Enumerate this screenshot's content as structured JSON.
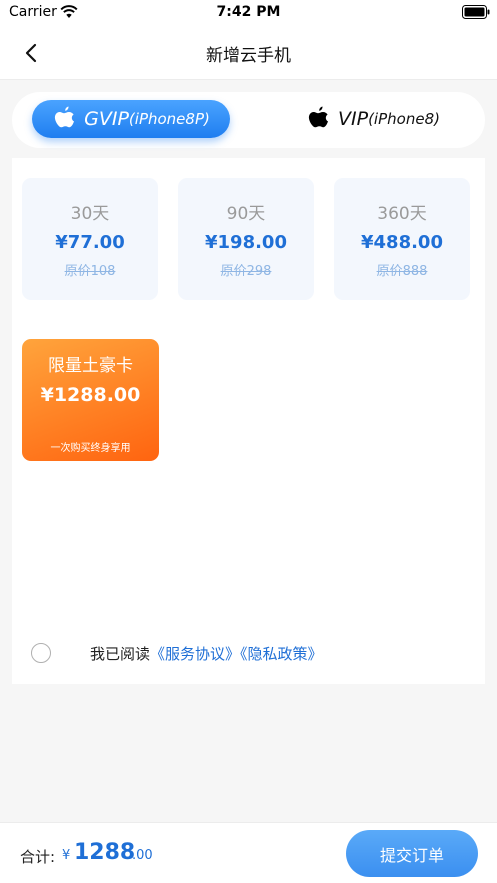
{
  "status_bar": {
    "carrier": "Carrier",
    "time": "7:42 PM"
  },
  "nav": {
    "title": "新增云手机",
    "back_icon": "chevron-left-icon"
  },
  "tabs": [
    {
      "label": "GVIP",
      "sub": "(iPhone8P)",
      "icon": "apple-icon",
      "active": true
    },
    {
      "label": "VIP",
      "sub": "(iPhone8)",
      "icon": "apple-icon",
      "active": false
    }
  ],
  "plans": [
    {
      "days": "30天",
      "price": "¥77.00",
      "original": "原价108"
    },
    {
      "days": "90天",
      "price": "¥198.00",
      "original": "原价298"
    },
    {
      "days": "360天",
      "price": "¥488.00",
      "original": "原价888"
    }
  ],
  "vip_card": {
    "name": "限量土豪卡",
    "price": "¥1288.00",
    "note": "一次购买终身享用"
  },
  "agreement": {
    "prefix": "我已阅读",
    "service": "《服务协议》",
    "privacy": "《隐私政策》",
    "checked": false
  },
  "footer": {
    "total_label": "合计:",
    "currency": "¥",
    "amount_int": "1288",
    "amount_dec": ".00",
    "submit": "提交订单"
  },
  "colors": {
    "accent": "#1f6fd6",
    "tab_active": "#1f7ef0",
    "vip_orange": "#ff6410"
  }
}
